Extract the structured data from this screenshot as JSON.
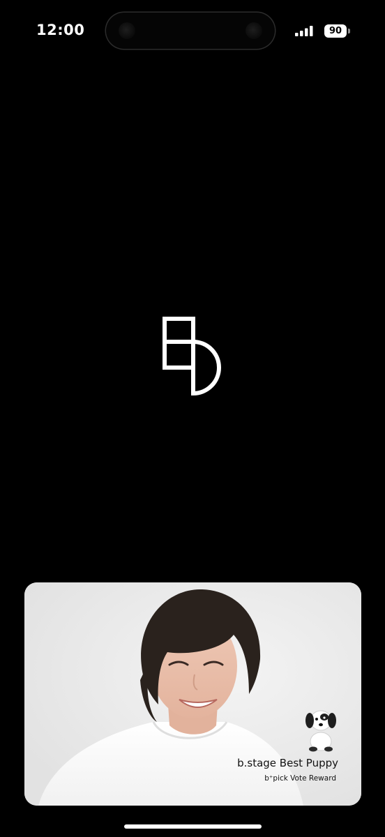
{
  "status_bar": {
    "time": "12:00",
    "battery": "90",
    "icons": [
      "cellular-signal-icon",
      "battery-icon"
    ]
  },
  "splash": {
    "logo": "b-stage-logo"
  },
  "promo_card": {
    "title": "b.stage Best Puppy",
    "subtitle": "b⁺pick Vote Reward",
    "icon": "puppy-icon"
  },
  "colors": {
    "background": "#000000",
    "foreground": "#ffffff",
    "card_background": "#ececec",
    "card_text": "#111111"
  }
}
